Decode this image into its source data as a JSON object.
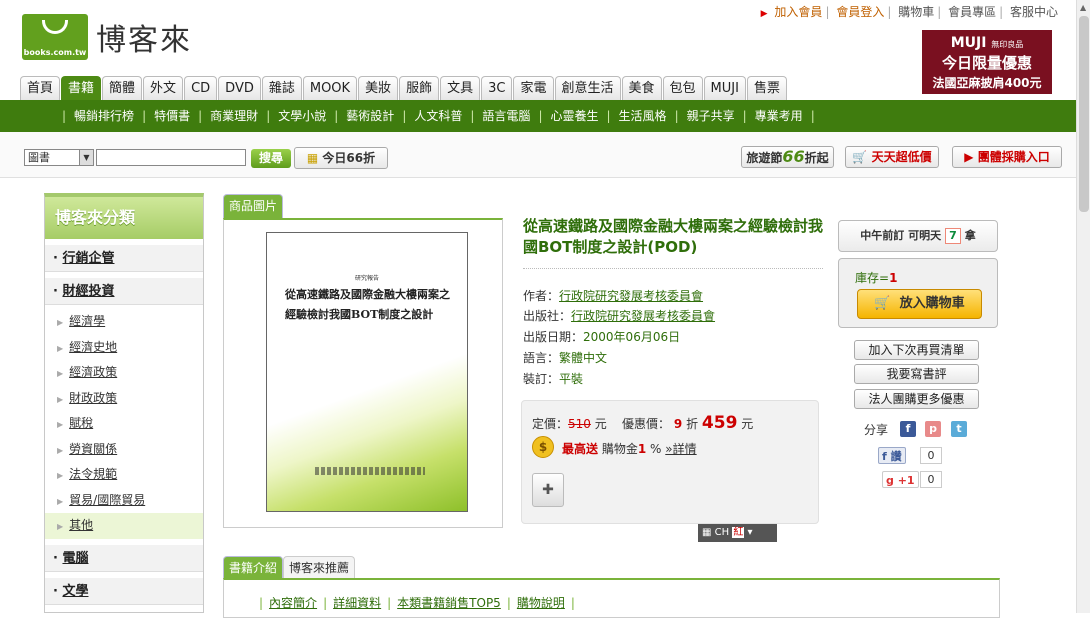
{
  "toplinks": [
    {
      "label": "加入會員",
      "accent": true
    },
    {
      "label": "會員登入",
      "accent": true
    },
    {
      "label": "購物車",
      "accent": false
    },
    {
      "label": "會員專區",
      "accent": false
    },
    {
      "label": "客服中心",
      "accent": false
    }
  ],
  "logo": {
    "name": "博客來",
    "domain": "books.com.tw"
  },
  "muji_ad": {
    "brand": "MUJI",
    "brand_sub": "無印良品",
    "line1": "今日限量優惠",
    "line2": "法國亞麻披肩400元"
  },
  "main_tabs": [
    "首頁",
    "書籍",
    "簡體",
    "外文",
    "CD",
    "DVD",
    "雜誌",
    "MOOK",
    "美妝",
    "服飾",
    "文具",
    "3C",
    "家電",
    "創意生活",
    "美食",
    "包包",
    "MUJI",
    "售票"
  ],
  "active_tab": "書籍",
  "subnav": [
    "暢銷排行榜",
    "特價書",
    "商業理財",
    "文學小說",
    "藝術設計",
    "人文科普",
    "語言電腦",
    "心靈養生",
    "生活風格",
    "親子共享",
    "專業考用"
  ],
  "search": {
    "category": "圖書",
    "value": "",
    "button": "搜尋",
    "today": "今日66折"
  },
  "promos": {
    "travel": "旅遊節",
    "travel_num": "66",
    "travel_suffix": "折起",
    "daily": "天天超低價",
    "group": "團體採購入口"
  },
  "sidebar": {
    "title": "博客來分類",
    "cat1": "行銷企管",
    "cat2": "財經投資",
    "subs": [
      "經濟學",
      "經濟史地",
      "經濟政策",
      "財政政策",
      "賦稅",
      "勞資關係",
      "法令規範",
      "貿易/國際貿易",
      "其他"
    ],
    "cat3": "電腦",
    "cat4": "文學"
  },
  "product_image_tab": "商品圖片",
  "cover": {
    "pre": "研究報告",
    "title": "從高速鐵路及國際金融大樓兩案之經驗檢討我國BOT制度之設計"
  },
  "product": {
    "title": "從高速鐵路及國際金融大樓兩案之經驗檢討我國BOT制度之設計(POD)",
    "author_label": "作者：",
    "author": "行政院研究發展考核委員會",
    "publisher_label": "出版社：",
    "publisher": "行政院研究發展考核委員會",
    "date_label": "出版日期：",
    "date": "2000年06月06日",
    "lang_label": "語言：",
    "lang": "繁體中文",
    "binding_label": "裝訂：",
    "binding": "平裝"
  },
  "price": {
    "list_label": "定價：",
    "list": "510",
    "unit": "元",
    "sale_label": "優惠價：",
    "discount": "9",
    "discount_suffix": "折",
    "sale": "459",
    "bonus_prefix": "最高送",
    "bonus_label": "購物金",
    "bonus_pct": "1",
    "bonus_unit": "%",
    "detail": "»詳情"
  },
  "ime": "CH",
  "right": {
    "delivery": "中午前訂 可明天",
    "delivery_suffix": "拿",
    "stock_label": "庫存=",
    "stock": "1",
    "cart": "放入購物車",
    "btn1": "加入下次再買清單",
    "btn2": "我要寫書評",
    "btn3": "法人團購更多優惠",
    "share": "分享",
    "fb_like": "讚",
    "fb_count": "0",
    "gplus": "+1",
    "gplus_count": "0"
  },
  "bottom_tabs": [
    "書籍介紹",
    "博客來推薦"
  ],
  "bottom_links": [
    "內容簡介",
    "詳細資料",
    "本類書籍銷售TOP5",
    "購物說明"
  ]
}
